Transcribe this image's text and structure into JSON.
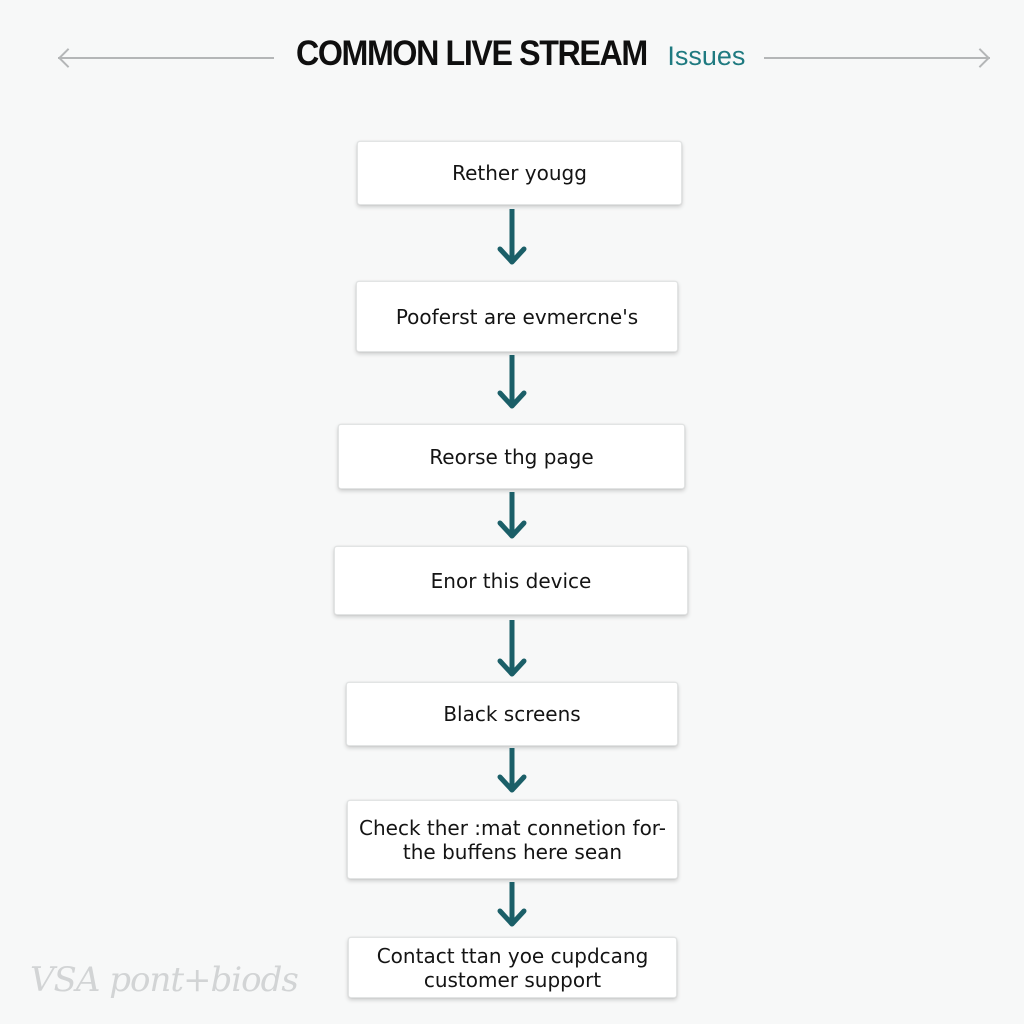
{
  "header": {
    "title_main": "COMMON LIVE STREAM",
    "title_accent": "Issues",
    "left_arrow_icon": "left-arrow-icon",
    "right_arrow_icon": "right-arrow-icon"
  },
  "colors": {
    "accent": "#1f7a80",
    "arrow": "#1b5f68",
    "header_line": "#b4b6b7",
    "box_bg": "#ffffff",
    "page_bg": "#f7f8f8"
  },
  "flow": {
    "steps": [
      {
        "label": "Rether yougg"
      },
      {
        "label": "Pooferst are evmercne's"
      },
      {
        "label": "Reorse thg page"
      },
      {
        "label": "Enor this device"
      },
      {
        "label": "Black screens"
      },
      {
        "label": "Check ther :mat connetion for- the buffens here sean"
      },
      {
        "label": "Contact ttan yoe cupdcang customer support"
      }
    ],
    "connector_icon": "down-arrow-icon"
  },
  "watermark": {
    "text": "VSA pont+biods"
  }
}
